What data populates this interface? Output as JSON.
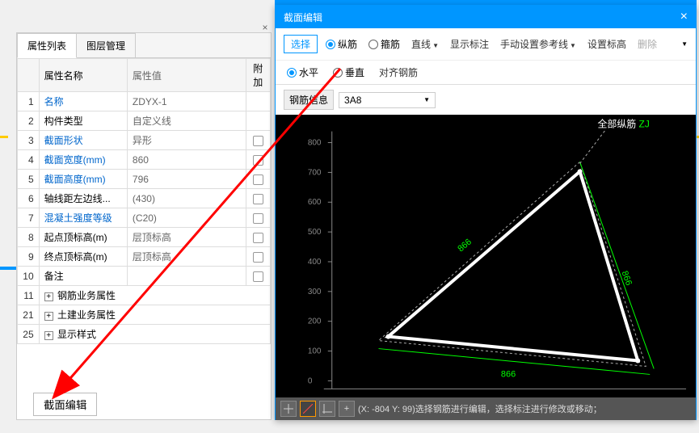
{
  "leftPanel": {
    "tabs": {
      "properties": "属性列表",
      "layers": "图层管理"
    },
    "headers": {
      "num": "",
      "name": "属性名称",
      "value": "属性值",
      "add": "附加"
    },
    "rows": [
      {
        "n": "1",
        "name": "名称",
        "value": "ZDYX-1",
        "link": true,
        "check": false
      },
      {
        "n": "2",
        "name": "构件类型",
        "value": "自定义线",
        "link": false,
        "check": false
      },
      {
        "n": "3",
        "name": "截面形状",
        "value": "异形",
        "link": true,
        "check": true
      },
      {
        "n": "4",
        "name": "截面宽度(mm)",
        "value": "860",
        "link": true,
        "check": true
      },
      {
        "n": "5",
        "name": "截面高度(mm)",
        "value": "796",
        "link": true,
        "check": true
      },
      {
        "n": "6",
        "name": "轴线距左边线...",
        "value": "(430)",
        "link": false,
        "check": true
      },
      {
        "n": "7",
        "name": "混凝土强度等级",
        "value": "(C20)",
        "link": true,
        "check": true
      },
      {
        "n": "8",
        "name": "起点顶标高(m)",
        "value": "层顶标高",
        "link": false,
        "check": true
      },
      {
        "n": "9",
        "name": "终点顶标高(m)",
        "value": "层顶标高",
        "link": false,
        "check": true
      },
      {
        "n": "10",
        "name": "备注",
        "value": "",
        "link": false,
        "check": true
      }
    ],
    "groups": [
      {
        "n": "11",
        "label": "钢筋业务属性"
      },
      {
        "n": "21",
        "label": "土建业务属性"
      },
      {
        "n": "25",
        "label": "显示样式"
      }
    ],
    "sectionEditBtn": "截面编辑"
  },
  "dialog": {
    "title": "截面编辑",
    "toolbar": {
      "select": "选择",
      "longitudinal": "纵筋",
      "stirrup": "箍筋",
      "line": "直线",
      "showDim": "显示标注",
      "manualRef": "手动设置参考线",
      "setElev": "设置标高",
      "delete": "删除"
    },
    "toolbar2": {
      "horizontal": "水平",
      "vertical": "垂直",
      "alignRebar": "对齐钢筋"
    },
    "rebarInfo": {
      "label": "钢筋信息",
      "value": "3A8"
    },
    "canvas": {
      "allLongitudinal": "全部纵筋",
      "zj": "ZJ",
      "dim1": "866",
      "dim2": "866",
      "dim3": "866",
      "ticks": [
        "0",
        "100",
        "200",
        "300",
        "400",
        "500",
        "600",
        "700",
        "800"
      ]
    },
    "status": "(X: -804 Y: 99)选择钢筋进行编辑，选择标注进行修改或移动；"
  }
}
